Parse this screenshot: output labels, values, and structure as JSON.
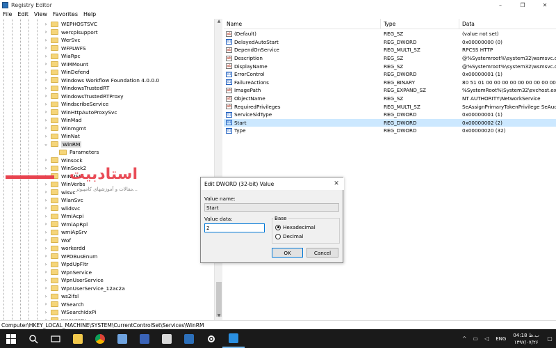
{
  "window": {
    "title": "Registry Editor",
    "controls": [
      "–",
      "❐",
      "✕"
    ]
  },
  "menu": [
    "File",
    "Edit",
    "View",
    "Favorites",
    "Help"
  ],
  "tree": {
    "items": [
      {
        "label": "WEPHOSTSVC",
        "expander": "›"
      },
      {
        "label": "wercplsupport",
        "expander": "›"
      },
      {
        "label": "WerSvc",
        "expander": "›"
      },
      {
        "label": "WFPLWFS",
        "expander": "›"
      },
      {
        "label": "WiaRpc",
        "expander": "›"
      },
      {
        "label": "WIMMount",
        "expander": "›"
      },
      {
        "label": "WinDefend",
        "expander": "›"
      },
      {
        "label": "Windows Workflow Foundation 4.0.0.0",
        "expander": "›"
      },
      {
        "label": "WindowsTrustedRT",
        "expander": "›"
      },
      {
        "label": "WindowsTrustedRTProxy",
        "expander": "›"
      },
      {
        "label": "WindscribeService",
        "expander": "›"
      },
      {
        "label": "WinHttpAutoProxySvc",
        "expander": "›"
      },
      {
        "label": "WinMad",
        "expander": "›"
      },
      {
        "label": "Winmgmt",
        "expander": "›"
      },
      {
        "label": "WinNat",
        "expander": "›"
      },
      {
        "label": "WinRM",
        "expander": "⌄",
        "selected": true
      },
      {
        "label": "Parameters",
        "expander": "",
        "child": true
      },
      {
        "label": "Winsock",
        "expander": "›"
      },
      {
        "label": "WinSock2",
        "expander": "›"
      },
      {
        "label": "WINUSB",
        "expander": "›"
      },
      {
        "label": "WinVerbs",
        "expander": "›"
      },
      {
        "label": "wisvc",
        "expander": "›"
      },
      {
        "label": "WlanSvc",
        "expander": "›"
      },
      {
        "label": "wlidsvc",
        "expander": "›"
      },
      {
        "label": "WmiAcpi",
        "expander": "›"
      },
      {
        "label": "WmiApRpl",
        "expander": "›"
      },
      {
        "label": "wmiApSrv",
        "expander": "›"
      },
      {
        "label": "Wof",
        "expander": "›"
      },
      {
        "label": "workerdd",
        "expander": "›"
      },
      {
        "label": "WPDBusEnum",
        "expander": "›"
      },
      {
        "label": "WpdUpFltr",
        "expander": "›"
      },
      {
        "label": "WpnService",
        "expander": "›"
      },
      {
        "label": "WpnUserService",
        "expander": "›"
      },
      {
        "label": "WpnUserService_12ac2a",
        "expander": "›"
      },
      {
        "label": "ws2ifsl",
        "expander": "›"
      },
      {
        "label": "WSearch",
        "expander": "›"
      },
      {
        "label": "WSearchIdxPi",
        "expander": "›"
      },
      {
        "label": "wuauserv",
        "expander": "›"
      }
    ]
  },
  "values": {
    "headers": {
      "name": "Name",
      "type": "Type",
      "data": "Data"
    },
    "rows": [
      {
        "icon": "ab",
        "name": "(Default)",
        "type": "REG_SZ",
        "data": "(value not set)"
      },
      {
        "icon": "bin",
        "name": "DelayedAutoStart",
        "type": "REG_DWORD",
        "data": "0x00000000 (0)"
      },
      {
        "icon": "ab",
        "name": "DependOnService",
        "type": "REG_MULTI_SZ",
        "data": "RPCSS HTTP"
      },
      {
        "icon": "ab",
        "name": "Description",
        "type": "REG_SZ",
        "data": "@%Systemroot%\\system32\\wsmsvc.dll,-"
      },
      {
        "icon": "ab",
        "name": "DisplayName",
        "type": "REG_SZ",
        "data": "@%Systemroot%\\system32\\wsmsvc.dll,-"
      },
      {
        "icon": "bin",
        "name": "ErrorControl",
        "type": "REG_DWORD",
        "data": "0x00000001 (1)"
      },
      {
        "icon": "bin",
        "name": "FailureActions",
        "type": "REG_BINARY",
        "data": "80 51 01 00 00 00 00 00 00 00 00 00 03 00 0"
      },
      {
        "icon": "ab",
        "name": "ImagePath",
        "type": "REG_EXPAND_SZ",
        "data": "%SystemRoot%\\System32\\svchost.exe -k"
      },
      {
        "icon": "ab",
        "name": "ObjectName",
        "type": "REG_SZ",
        "data": "NT AUTHORITY\\NetworkService"
      },
      {
        "icon": "ab",
        "name": "RequiredPrivileges",
        "type": "REG_MULTI_SZ",
        "data": "SeAssignPrimaryTokenPrivilege SeAuditPr"
      },
      {
        "icon": "bin",
        "name": "ServiceSidType",
        "type": "REG_DWORD",
        "data": "0x00000001 (1)"
      },
      {
        "icon": "bin",
        "name": "Start",
        "type": "REG_DWORD",
        "data": "0x00000002 (2)",
        "selected": true
      },
      {
        "icon": "bin",
        "name": "Type",
        "type": "REG_DWORD",
        "data": "0x00000020 (32)"
      }
    ]
  },
  "status": {
    "path": "Computer\\HKEY_LOCAL_MACHINE\\SYSTEM\\CurrentControlSet\\Services\\WinRM"
  },
  "watermark": {
    "title": "استادبیت",
    "subtitle": "مقالات و آموزشهای کامپیوتر..."
  },
  "dialog": {
    "title": "Edit DWORD (32-bit) Value",
    "close": "✕",
    "value_name_label": "Value name:",
    "value_name": "Start",
    "value_data_label": "Value data:",
    "value_data": "2",
    "base_label": "Base",
    "hex_label": "Hexadecimal",
    "dec_label": "Decimal",
    "hex_selected": true,
    "ok_label": "OK",
    "cancel_label": "Cancel"
  },
  "taskbar": {
    "apps": [
      {
        "name": "start",
        "color": "#ffffff"
      },
      {
        "name": "search",
        "color": "#ffffff"
      },
      {
        "name": "task-view",
        "color": "#ffffff"
      },
      {
        "name": "file-explorer",
        "color": "#f2c94c"
      },
      {
        "name": "chrome",
        "color": "#4a8ee0"
      },
      {
        "name": "documents",
        "color": "#6fa3df"
      },
      {
        "name": "visual-studio",
        "color": "#3a63b7"
      },
      {
        "name": "app-8",
        "color": "#d9d9d9"
      },
      {
        "name": "photoshop",
        "color": "#2c6fb9"
      },
      {
        "name": "settings",
        "color": "#ffffff"
      },
      {
        "name": "regedit",
        "color": "#2a8fe0"
      }
    ],
    "lang": "ENG",
    "time": "04:18 ب.ظ",
    "date": "۱۳۹۷/۰۷/۲۶"
  }
}
